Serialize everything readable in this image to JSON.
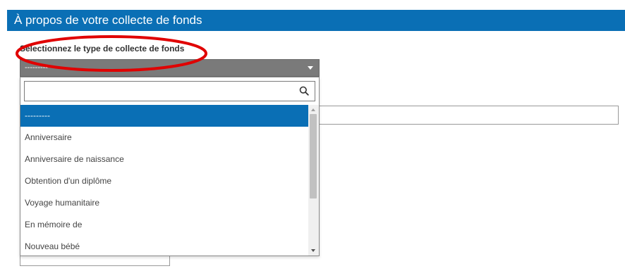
{
  "section": {
    "title": "À propos de votre collecte de fonds"
  },
  "field": {
    "label": "Sélectionnez le type de collecte de fonds",
    "selected_value": "---------"
  },
  "dropdown": {
    "search_value": "",
    "options": [
      {
        "label": "---------",
        "selected": true
      },
      {
        "label": "Anniversaire",
        "selected": false
      },
      {
        "label": "Anniversaire de naissance",
        "selected": false
      },
      {
        "label": "Obtention d'un diplôme",
        "selected": false
      },
      {
        "label": "Voyage humanitaire",
        "selected": false
      },
      {
        "label": "En mémoire de",
        "selected": false
      },
      {
        "label": "Nouveau bébé",
        "selected": false
      }
    ]
  },
  "colors": {
    "header_bg": "#0a6fb5",
    "select_bg": "#7a7a7a",
    "selected_option_bg": "#0a6fb5",
    "annotation": "#e00000"
  },
  "icons": {
    "search": "search-icon",
    "caret": "chevron-down-icon"
  }
}
